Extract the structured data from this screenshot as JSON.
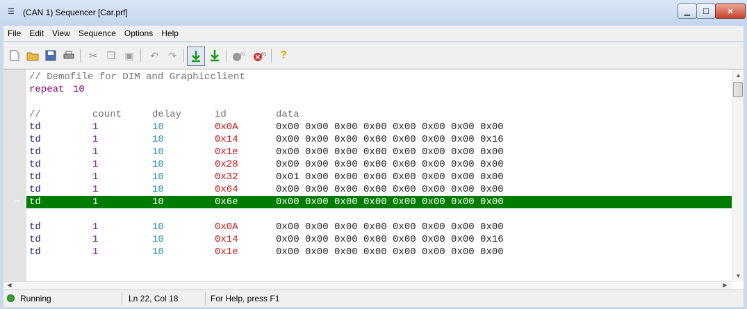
{
  "window": {
    "title": "(CAN 1) Sequencer [Car.prf]",
    "title_icon": "list-icon"
  },
  "menu": [
    "File",
    "Edit",
    "View",
    "Sequence",
    "Options",
    "Help"
  ],
  "toolbar": {
    "buttons": [
      "new-file-icon",
      "open-file-icon",
      "save-icon",
      "print-icon",
      "cut-icon",
      "copy-icon",
      "paste-icon",
      "undo-icon",
      "redo-icon",
      "download-active-icon",
      "download-icon",
      "send-data-icon",
      "stop-data-icon",
      "help-icon"
    ]
  },
  "editor": {
    "lines": [
      {
        "type": "comment",
        "text": "// Demofile for DIM and Graphicclient"
      },
      {
        "type": "repeat",
        "kw": "repeat",
        "value": "10"
      },
      {
        "type": "blank"
      },
      {
        "type": "header",
        "cmd": "//",
        "count": "count",
        "delay": "delay",
        "id": "id",
        "data": "data"
      },
      {
        "type": "row",
        "cmd": "td",
        "count": "1",
        "delay": "10",
        "id": "0x0A",
        "data": "0x00 0x00 0x00 0x00 0x00 0x00 0x00 0x00"
      },
      {
        "type": "row",
        "cmd": "td",
        "count": "1",
        "delay": "10",
        "id": "0x14",
        "data": "0x00 0x00 0x00 0x00 0x00 0x00 0x00 0x16"
      },
      {
        "type": "row",
        "cmd": "td",
        "count": "1",
        "delay": "10",
        "id": "0x1e",
        "data": "0x00 0x00 0x00 0x00 0x00 0x00 0x00 0x00"
      },
      {
        "type": "row",
        "cmd": "td",
        "count": "1",
        "delay": "10",
        "id": "0x28",
        "data": "0x00 0x00 0x00 0x00 0x00 0x00 0x00 0x00"
      },
      {
        "type": "row",
        "cmd": "td",
        "count": "1",
        "delay": "10",
        "id": "0x32",
        "data": "0x01 0x00 0x00 0x00 0x00 0x00 0x00 0x00"
      },
      {
        "type": "row",
        "cmd": "td",
        "count": "1",
        "delay": "10",
        "id": "0x64",
        "data": "0x00 0x00 0x00 0x00 0x00 0x00 0x00 0x00"
      },
      {
        "type": "row",
        "cmd": "td",
        "count": "1",
        "delay": "10",
        "id": "0x6e",
        "data": "0x00 0x00 0x00 0x00 0x00 0x00 0x00 0x00",
        "current": true
      },
      {
        "type": "blank"
      },
      {
        "type": "row",
        "cmd": "td",
        "count": "1",
        "delay": "10",
        "id": "0x0A",
        "data": "0x00 0x00 0x00 0x00 0x00 0x00 0x00 0x00"
      },
      {
        "type": "row",
        "cmd": "td",
        "count": "1",
        "delay": "10",
        "id": "0x14",
        "data": "0x00 0x00 0x00 0x00 0x00 0x00 0x00 0x16"
      },
      {
        "type": "row",
        "cmd": "td",
        "count": "1",
        "delay": "10",
        "id": "0x1e",
        "data": "0x00 0x00 0x00 0x00 0x00 0x00 0x00 0x00"
      }
    ],
    "highlight_color": "#007c00",
    "current_line_marker": "arrow-right-icon"
  },
  "status": {
    "state": "Running",
    "position": "Ln 22, Col 18",
    "help": "For Help, press F1"
  }
}
